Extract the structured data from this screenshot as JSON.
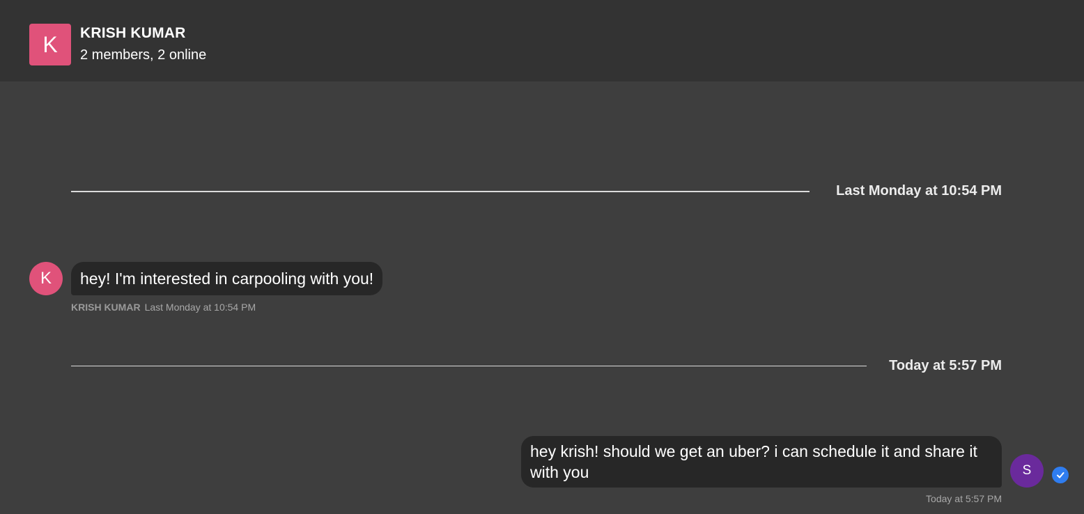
{
  "header": {
    "avatar_letter": "K",
    "title": "KRISH KUMAR",
    "subtitle": "2 members, 2 online"
  },
  "dividers": [
    {
      "label": "Last Monday at 10:54 PM"
    },
    {
      "label": "Today at 5:57 PM"
    }
  ],
  "messages": [
    {
      "avatar_letter": "K",
      "text": "hey! I'm interested in carpooling with you!",
      "author": "KRISH KUMAR",
      "time": "Last Monday at 10:54 PM"
    },
    {
      "avatar_letter": "S",
      "text": "hey krish! should we get an uber? i can schedule it and share it with you",
      "time": "Today at 5:57 PM",
      "status_icon": "read-check-icon"
    }
  ],
  "colors": {
    "header_bg": "#333333",
    "chat_bg": "#3e3e3e",
    "bubble_bg": "#272727",
    "krish_avatar": "#e0527a",
    "self_avatar": "#6a2a9c",
    "read_check": "#2f7df0"
  }
}
